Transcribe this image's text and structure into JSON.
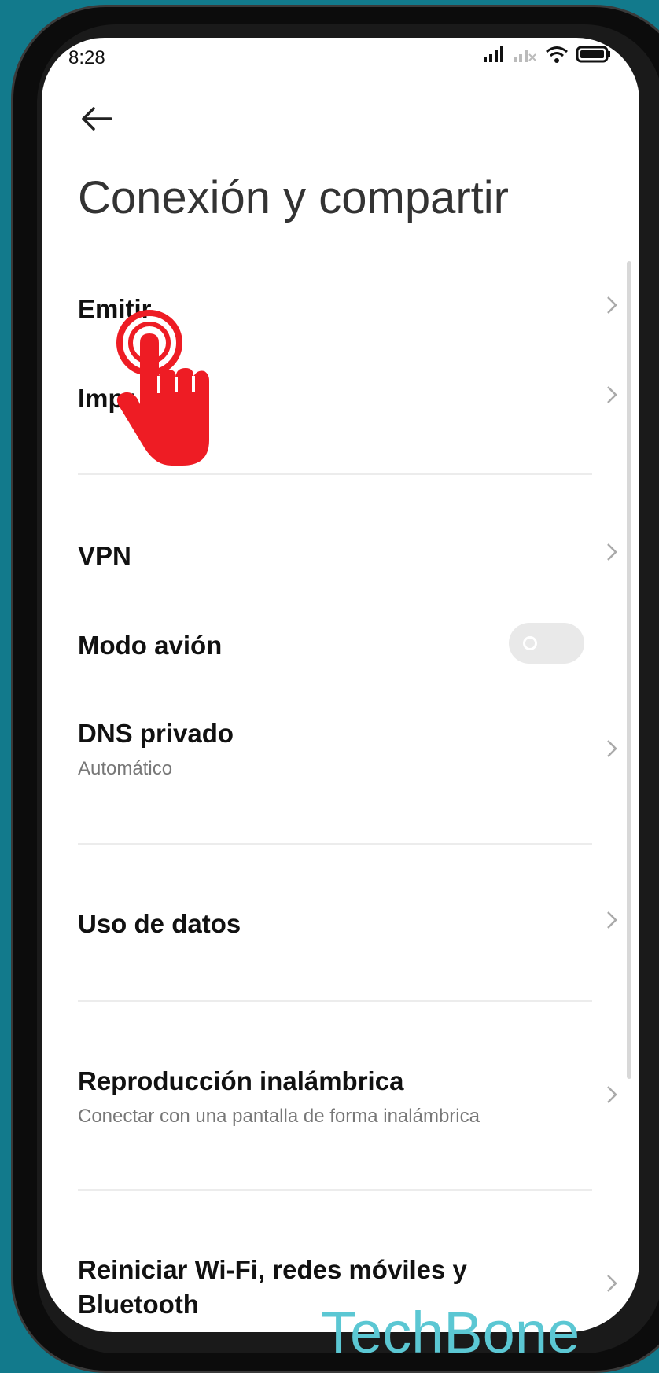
{
  "status_bar": {
    "time": "8:28"
  },
  "header": {
    "title": "Conexión y compartir"
  },
  "items": [
    {
      "label": "Emitir"
    },
    {
      "label": "Impr"
    },
    {
      "label": "VPN"
    },
    {
      "label": "Modo avión",
      "toggle_on": false
    },
    {
      "label": "DNS privado",
      "sub": "Automático"
    },
    {
      "label": "Uso de datos"
    },
    {
      "label": "Reproducción inalámbrica",
      "sub": "Conectar con una pantalla de forma inalámbrica"
    },
    {
      "label_line1": "Reiniciar Wi-Fi, redes móviles y",
      "label_line2": "Bluetooth"
    }
  ],
  "watermark": "TechBone",
  "colors": {
    "hand": "#ee1c24",
    "watermark": "#5bc7d3",
    "background": "#127a8c"
  }
}
